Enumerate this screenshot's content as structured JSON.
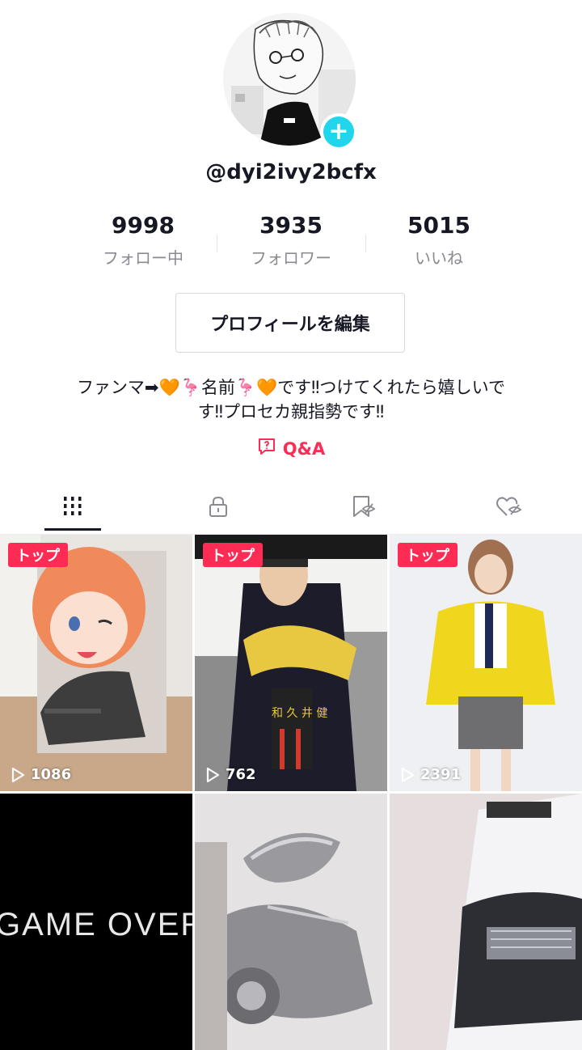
{
  "profile": {
    "username": "@dyi2ivy2bcfx",
    "add_icon": "+"
  },
  "stats": [
    {
      "value": "9998",
      "label": "フォロー中"
    },
    {
      "value": "3935",
      "label": "フォロワー"
    },
    {
      "value": "5015",
      "label": "いいね"
    }
  ],
  "edit_button": "プロフィールを編集",
  "bio": {
    "line1": "ファンマ➡🧡🦩名前🦩🧡です‼つけてくれたら嬉しいで",
    "line2": "す‼プロセカ親指勢です‼"
  },
  "qa_link": "Q&A",
  "tabs": [
    {
      "icon": "grid-icon",
      "active": true
    },
    {
      "icon": "lock-icon",
      "active": false
    },
    {
      "icon": "bookmark-icon",
      "active": false
    },
    {
      "icon": "liked-heart-icon",
      "active": false
    }
  ],
  "videos": [
    {
      "badge": "トップ",
      "views": "1086"
    },
    {
      "badge": "トップ",
      "views": "762"
    },
    {
      "badge": "トップ",
      "views": "2391"
    },
    {
      "badge": "",
      "views": "",
      "overlay_text": "GAME OVER"
    },
    {
      "badge": "",
      "views": ""
    },
    {
      "badge": "",
      "views": ""
    }
  ],
  "colors": {
    "accent": "#fe2c55",
    "add_badge": "#20d5ec",
    "text_primary": "#161823",
    "text_secondary": "#8a8b91"
  }
}
